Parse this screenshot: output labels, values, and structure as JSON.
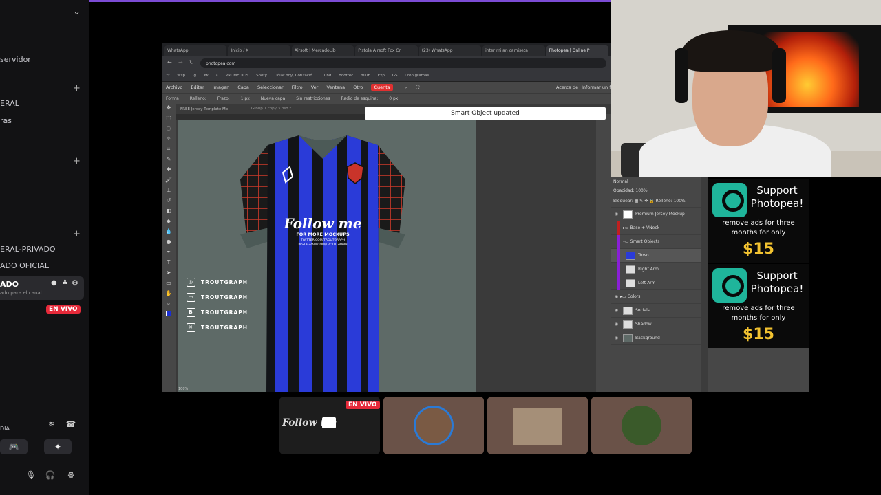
{
  "sidebar": {
    "items": [
      "servidor",
      "ERAL",
      "ras",
      "ERAL-PRIVADO",
      "ADO OFICIAL"
    ],
    "active_channel": "ADO",
    "active_sub": "ado para el canal",
    "live_badge": "EN VIVO",
    "voice_label": "DIA"
  },
  "browser": {
    "tabs": [
      "WhatsApp",
      "Inicio / X",
      "Airsoft | MercadoLib",
      "Pistola Airsoft Fox Cr",
      "(23) WhatsApp",
      "inter milan camiseta",
      "Photopea | Online P"
    ],
    "url": "photopea.com",
    "bookmarks": [
      "Yt",
      "Wsp",
      "Ig",
      "Tw",
      "X",
      "PROMEDIOS",
      "Spoty",
      "Dólar hoy, Cotizació...",
      "Tind",
      "Bootrec",
      "mlub",
      "Exp",
      "GS",
      "Cronigramas"
    ],
    "menu": [
      "Archivo",
      "Editar",
      "Imagen",
      "Capa",
      "Seleccionar",
      "Filtro",
      "Ver",
      "Ventana",
      "Otro"
    ],
    "menu_account": "Cuenta",
    "menu_right": [
      "Acerca de",
      "Informar un fa"
    ],
    "options": [
      "Forma",
      "Relleno:",
      "Frazo:",
      "1 px",
      "Nueva capa",
      "Sin restricciones",
      "Radio de esquina:",
      "0 px"
    ],
    "doc_tabs": [
      "FREE Jersey Template Mo",
      "Group 1 copy 3.psd *"
    ],
    "toast": "Smart Object updated",
    "socials": [
      "TROUTGRAPH",
      "TROUTGRAPH",
      "TROUTGRAPH",
      "TROUTGRAPH"
    ],
    "jersey_text": {
      "main": "Follow me",
      "sub": "FOR MORE MOCKUPS",
      "line1": "TWITTER.COM/TROUTGRAPH",
      "line2": "INSTAGRAM.COM/TROUTGRAPH"
    },
    "status": "100%"
  },
  "layers": {
    "blend": "Normal",
    "opacity_label": "Opacidad:",
    "opacity": "100%",
    "lock_label": "Bloquear:",
    "fill_label": "Relleno:",
    "fill": "100%",
    "items": [
      "Premium Jersey Mockup",
      "Base + VNeck",
      "Smart Objects",
      "Torso",
      "Right Arm",
      "Left Arm",
      "Colors",
      "Socials",
      "Shadow",
      "Background"
    ]
  },
  "ads": [
    {
      "title": "Support Photopea!",
      "body": "remove ads for three months for only",
      "price": "$15"
    },
    {
      "title": "Support Photopea!",
      "body": "remove ads for three months for only",
      "price": "$15"
    }
  ],
  "stage": {
    "live_badge": "EN VIVO",
    "preview_text": "Follow me"
  },
  "colors": {
    "accent": "#7b4bd4",
    "live": "#e62a3a",
    "photopea_green": "#1fb59b",
    "price": "#f2c230"
  }
}
